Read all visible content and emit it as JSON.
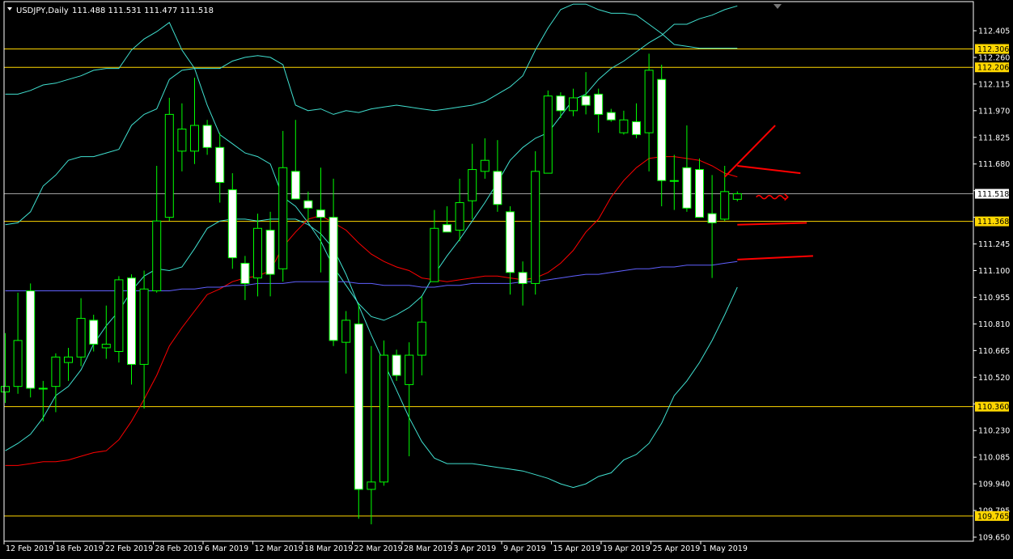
{
  "header": {
    "symbol": "USDJPY,Daily",
    "ohlc": "111.488 111.531 111.477 111.518"
  },
  "colors": {
    "background": "#000000",
    "frame": "#ffffff",
    "bull_candle_body": "#000000",
    "bear_candle_body": "#ffffff",
    "candle_outline": "#00ff00",
    "bollinger_bands": "#40e0d0",
    "ma_red": "#ff0000",
    "ma_blue": "#6060ff",
    "horizontal_levels": "#ffd700",
    "current_price_line": "#a0a0a0",
    "annotation": "#ff0000",
    "tag_text": "#000000"
  },
  "chart_data": {
    "type": "candlestick",
    "symbol": "USDJPY",
    "timeframe": "Daily",
    "ylim": [
      109.65,
      112.5
    ],
    "y_ticks": [
      "112.405",
      "112.260",
      "112.115",
      "111.970",
      "111.825",
      "111.680",
      "111.535",
      "111.390",
      "111.245",
      "111.100",
      "110.955",
      "110.810",
      "110.665",
      "110.520",
      "110.375",
      "110.230",
      "110.085",
      "109.940",
      "109.795",
      "109.650"
    ],
    "x_tick_labels": [
      {
        "label": "12 Feb 2019",
        "index": 1
      },
      {
        "label": "18 Feb 2019",
        "index": 5
      },
      {
        "label": "22 Feb 2019",
        "index": 9
      },
      {
        "label": "28 Feb 2019",
        "index": 13
      },
      {
        "label": "6 Mar 2019",
        "index": 17
      },
      {
        "label": "12 Mar 2019",
        "index": 21
      },
      {
        "label": "18 Mar 2019",
        "index": 25
      },
      {
        "label": "22 Mar 2019",
        "index": 29
      },
      {
        "label": "28 Mar 2019",
        "index": 33
      },
      {
        "label": "3 Apr 2019",
        "index": 37
      },
      {
        "label": "9 Apr 2019",
        "index": 41
      },
      {
        "label": "15 Apr 2019",
        "index": 45
      },
      {
        "label": "19 Apr 2019",
        "index": 49
      },
      {
        "label": "25 Apr 2019",
        "index": 53
      },
      {
        "label": "1 May 2019",
        "index": 57
      }
    ],
    "candles": [
      {
        "o": 110.44,
        "h": 110.76,
        "l": 110.38,
        "c": 110.47
      },
      {
        "o": 110.47,
        "h": 110.98,
        "l": 110.43,
        "c": 110.72
      },
      {
        "o": 110.99,
        "h": 111.03,
        "l": 110.41,
        "c": 110.46
      },
      {
        "o": 110.46,
        "h": 110.5,
        "l": 110.28,
        "c": 110.46
      },
      {
        "o": 110.47,
        "h": 110.65,
        "l": 110.33,
        "c": 110.63
      },
      {
        "o": 110.6,
        "h": 110.68,
        "l": 110.5,
        "c": 110.63
      },
      {
        "o": 110.63,
        "h": 110.95,
        "l": 110.58,
        "c": 110.84
      },
      {
        "o": 110.83,
        "h": 110.86,
        "l": 110.66,
        "c": 110.7
      },
      {
        "o": 110.68,
        "h": 110.91,
        "l": 110.62,
        "c": 110.7
      },
      {
        "o": 110.66,
        "h": 111.07,
        "l": 110.6,
        "c": 111.05
      },
      {
        "o": 111.06,
        "h": 111.08,
        "l": 110.48,
        "c": 110.59
      },
      {
        "o": 110.59,
        "h": 111.1,
        "l": 110.35,
        "c": 111.0
      },
      {
        "o": 110.99,
        "h": 111.67,
        "l": 110.98,
        "c": 111.37
      },
      {
        "o": 111.39,
        "h": 112.04,
        "l": 111.37,
        "c": 111.95
      },
      {
        "o": 111.75,
        "h": 112.01,
        "l": 111.64,
        "c": 111.87
      },
      {
        "o": 111.75,
        "h": 112.15,
        "l": 111.68,
        "c": 111.89
      },
      {
        "o": 111.89,
        "h": 111.92,
        "l": 111.73,
        "c": 111.77
      },
      {
        "o": 111.77,
        "h": 111.85,
        "l": 111.47,
        "c": 111.58
      },
      {
        "o": 111.54,
        "h": 111.63,
        "l": 111.11,
        "c": 111.17
      },
      {
        "o": 111.14,
        "h": 111.18,
        "l": 110.94,
        "c": 111.03
      },
      {
        "o": 111.06,
        "h": 111.41,
        "l": 110.96,
        "c": 111.33
      },
      {
        "o": 111.32,
        "h": 111.42,
        "l": 110.96,
        "c": 111.08
      },
      {
        "o": 111.11,
        "h": 111.86,
        "l": 111.04,
        "c": 111.66
      },
      {
        "o": 111.64,
        "h": 111.92,
        "l": 111.5,
        "c": 111.49
      },
      {
        "o": 111.48,
        "h": 111.53,
        "l": 111.37,
        "c": 111.44
      },
      {
        "o": 111.43,
        "h": 111.66,
        "l": 111.09,
        "c": 111.39
      },
      {
        "o": 111.39,
        "h": 111.6,
        "l": 110.69,
        "c": 110.72
      },
      {
        "o": 110.71,
        "h": 110.88,
        "l": 110.54,
        "c": 110.83
      },
      {
        "o": 110.81,
        "h": 110.92,
        "l": 109.75,
        "c": 109.91
      },
      {
        "o": 109.91,
        "h": 110.69,
        "l": 109.72,
        "c": 109.95
      },
      {
        "o": 109.95,
        "h": 110.72,
        "l": 109.93,
        "c": 110.64
      },
      {
        "o": 110.64,
        "h": 110.67,
        "l": 110.5,
        "c": 110.53
      },
      {
        "o": 110.48,
        "h": 110.71,
        "l": 110.09,
        "c": 110.64
      },
      {
        "o": 110.64,
        "h": 110.96,
        "l": 110.53,
        "c": 110.82
      },
      {
        "o": 111.04,
        "h": 111.43,
        "l": 111.04,
        "c": 111.33
      },
      {
        "o": 111.35,
        "h": 111.45,
        "l": 111.31,
        "c": 111.31
      },
      {
        "o": 111.32,
        "h": 111.6,
        "l": 111.26,
        "c": 111.47
      },
      {
        "o": 111.48,
        "h": 111.79,
        "l": 111.38,
        "c": 111.65
      },
      {
        "o": 111.64,
        "h": 111.82,
        "l": 111.6,
        "c": 111.7
      },
      {
        "o": 111.64,
        "h": 111.81,
        "l": 111.42,
        "c": 111.46
      },
      {
        "o": 111.42,
        "h": 111.45,
        "l": 110.97,
        "c": 111.09
      },
      {
        "o": 111.09,
        "h": 111.15,
        "l": 110.91,
        "c": 111.03
      },
      {
        "o": 111.03,
        "h": 111.75,
        "l": 110.97,
        "c": 111.64
      },
      {
        "o": 111.63,
        "h": 112.08,
        "l": 111.64,
        "c": 112.05
      },
      {
        "o": 112.05,
        "h": 112.07,
        "l": 111.93,
        "c": 111.97
      },
      {
        "o": 111.97,
        "h": 112.09,
        "l": 111.94,
        "c": 112.04
      },
      {
        "o": 112.05,
        "h": 112.18,
        "l": 111.95,
        "c": 112.0
      },
      {
        "o": 112.06,
        "h": 112.09,
        "l": 111.85,
        "c": 111.95
      },
      {
        "o": 111.96,
        "h": 111.98,
        "l": 111.91,
        "c": 111.92
      },
      {
        "o": 111.85,
        "h": 111.97,
        "l": 111.84,
        "c": 111.92
      },
      {
        "o": 111.91,
        "h": 112.01,
        "l": 111.82,
        "c": 111.84
      },
      {
        "o": 111.85,
        "h": 112.28,
        "l": 111.64,
        "c": 112.19
      },
      {
        "o": 112.14,
        "h": 112.22,
        "l": 111.45,
        "c": 111.59
      },
      {
        "o": 111.59,
        "h": 111.73,
        "l": 111.43,
        "c": 111.59
      },
      {
        "o": 111.66,
        "h": 111.89,
        "l": 111.42,
        "c": 111.44
      },
      {
        "o": 111.65,
        "h": 111.71,
        "l": 111.39,
        "c": 111.39
      },
      {
        "o": 111.41,
        "h": 111.62,
        "l": 111.06,
        "c": 111.36
      },
      {
        "o": 111.38,
        "h": 111.67,
        "l": 111.37,
        "c": 111.53
      },
      {
        "o": 111.488,
        "h": 111.531,
        "l": 111.477,
        "c": 111.518
      }
    ],
    "series": [
      {
        "values": [
          112.06,
          112.06,
          112.08,
          112.11,
          112.12,
          112.14,
          112.16,
          112.19,
          112.2,
          112.2,
          112.3,
          112.36,
          112.4,
          112.45,
          112.3,
          112.2,
          112.0,
          111.84,
          111.79,
          111.74,
          111.72,
          111.68,
          111.5,
          111.45,
          111.36,
          111.26,
          111.12,
          111.02,
          110.92,
          110.85,
          110.83,
          110.86,
          110.9,
          110.96,
          111.08,
          111.18,
          111.27,
          111.37,
          111.47,
          111.58,
          111.7,
          111.77,
          111.82,
          111.85,
          111.94,
          112.03,
          112.06,
          112.14,
          112.2,
          112.24,
          112.29,
          112.34,
          112.38,
          112.44,
          112.44,
          112.47,
          112.49,
          112.52,
          112.54
        ]
      },
      {
        "values": [
          110.04,
          110.04,
          110.05,
          110.06,
          110.06,
          110.07,
          110.09,
          110.11,
          110.12,
          110.18,
          110.28,
          110.4,
          110.53,
          110.69,
          110.79,
          110.88,
          110.97,
          111.0,
          111.04,
          111.06,
          111.07,
          111.1,
          111.23,
          111.31,
          111.38,
          111.4,
          111.36,
          111.32,
          111.25,
          111.19,
          111.15,
          111.12,
          111.1,
          111.06,
          111.05,
          111.04,
          111.05,
          111.06,
          111.07,
          111.07,
          111.06,
          111.05,
          111.06,
          111.09,
          111.14,
          111.21,
          111.31,
          111.38,
          111.5,
          111.59,
          111.66,
          111.71,
          111.72,
          111.72,
          111.71,
          111.7,
          111.67,
          111.63,
          111.61
        ]
      },
      {
        "values": [
          110.99,
          110.99,
          110.99,
          110.99,
          110.99,
          110.99,
          110.99,
          110.99,
          110.99,
          110.99,
          110.99,
          110.99,
          110.99,
          110.99,
          111.0,
          111.0,
          111.01,
          111.01,
          111.02,
          111.02,
          111.03,
          111.03,
          111.03,
          111.04,
          111.04,
          111.04,
          111.04,
          111.04,
          111.03,
          111.03,
          111.02,
          111.02,
          111.02,
          111.01,
          111.01,
          111.02,
          111.02,
          111.03,
          111.03,
          111.03,
          111.03,
          111.04,
          111.04,
          111.05,
          111.06,
          111.07,
          111.08,
          111.08,
          111.09,
          111.1,
          111.11,
          111.11,
          111.12,
          111.12,
          111.13,
          111.13,
          111.13,
          111.14,
          111.15
        ]
      }
    ],
    "bollinger_upper": [
      111.35,
      111.36,
      111.42,
      111.56,
      111.62,
      111.7,
      111.72,
      111.72,
      111.74,
      111.76,
      111.89,
      111.95,
      111.98,
      112.14,
      112.19,
      112.2,
      112.2,
      112.2,
      112.24,
      112.26,
      112.27,
      112.26,
      112.22,
      112.0,
      111.97,
      111.98,
      111.95,
      111.97,
      111.96,
      111.98,
      111.99,
      112.0,
      111.99,
      111.98,
      111.97,
      111.98,
      111.99,
      112.0,
      112.02,
      112.06,
      112.1,
      112.16,
      112.3,
      112.42,
      112.52,
      112.55,
      112.55,
      112.52,
      112.5,
      112.5,
      112.49,
      112.44,
      112.39,
      112.33,
      112.32,
      112.31,
      112.31,
      112.31,
      112.31
    ],
    "bollinger_lower": [
      110.12,
      110.16,
      110.21,
      110.3,
      110.42,
      110.47,
      110.56,
      110.7,
      110.8,
      110.88,
      110.99,
      111.07,
      111.11,
      111.1,
      111.12,
      111.22,
      111.33,
      111.37,
      111.38,
      111.38,
      111.37,
      111.38,
      111.38,
      111.38,
      111.35,
      111.3,
      111.22,
      111.08,
      110.91,
      110.75,
      110.6,
      110.45,
      110.3,
      110.17,
      110.08,
      110.05,
      110.05,
      110.05,
      110.04,
      110.03,
      110.02,
      110.01,
      109.99,
      109.97,
      109.94,
      109.92,
      109.94,
      109.98,
      110.0,
      110.07,
      110.1,
      110.16,
      110.27,
      110.42,
      110.5,
      110.6,
      110.72,
      110.86,
      111.01
    ],
    "horizontal_levels": [
      {
        "value": 112.306,
        "label": "112.306"
      },
      {
        "value": 112.206,
        "label": "112.206"
      },
      {
        "value": 111.368,
        "label": "111.368"
      },
      {
        "value": 110.36,
        "label": "110.360"
      },
      {
        "value": 109.765,
        "label": "109.765"
      }
    ],
    "current_price": {
      "value": 111.518,
      "label": "111.518"
    },
    "annotations": [
      {
        "type": "line",
        "from": {
          "index": 57,
          "price": 111.61
        },
        "to": {
          "index": 61,
          "price": 111.89
        }
      },
      {
        "type": "line",
        "from": {
          "index": 58,
          "price": 111.67
        },
        "to": {
          "index": 63,
          "price": 111.63
        }
      },
      {
        "type": "line",
        "from": {
          "index": 58,
          "price": 111.35
        },
        "to": {
          "index": 63.5,
          "price": 111.36
        }
      },
      {
        "type": "line",
        "from": {
          "index": 58,
          "price": 111.16
        },
        "to": {
          "index": 64,
          "price": 111.18
        }
      },
      {
        "type": "squiggle",
        "from": {
          "index": 59.5,
          "price": 111.5
        },
        "to": {
          "index": 62,
          "price": 111.5
        }
      }
    ]
  }
}
